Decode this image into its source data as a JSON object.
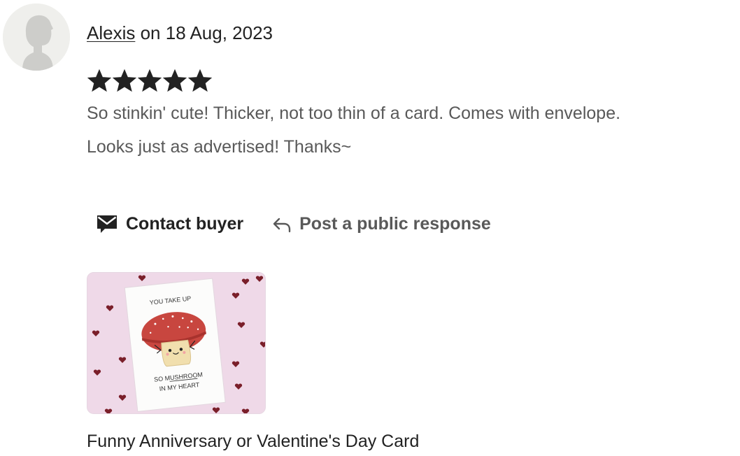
{
  "review": {
    "reviewer_name": "Alexis",
    "date_prefix": " on ",
    "date": "18 Aug, 2023",
    "rating": 5,
    "rating_max": 5,
    "text_line1": "So stinkin' cute! Thicker, not too thin of a card. Comes with envelope.",
    "text_line2": "Looks just as advertised! Thanks~"
  },
  "actions": {
    "contact_label": "Contact buyer",
    "contact_icon": "envelope-icon",
    "respond_label": "Post a public response",
    "respond_icon": "reply-arrow-icon"
  },
  "product": {
    "title": "Funny Anniversary or Valentine's Day Card",
    "card_text_top": "YOU TAKE UP",
    "card_text_mid": "SO MUSHROOM",
    "card_text_bottom": "IN MY HEART"
  },
  "colors": {
    "text_primary": "#222222",
    "text_secondary": "#595959",
    "star": "#222222",
    "thumb_bg": "#efd9e8"
  }
}
